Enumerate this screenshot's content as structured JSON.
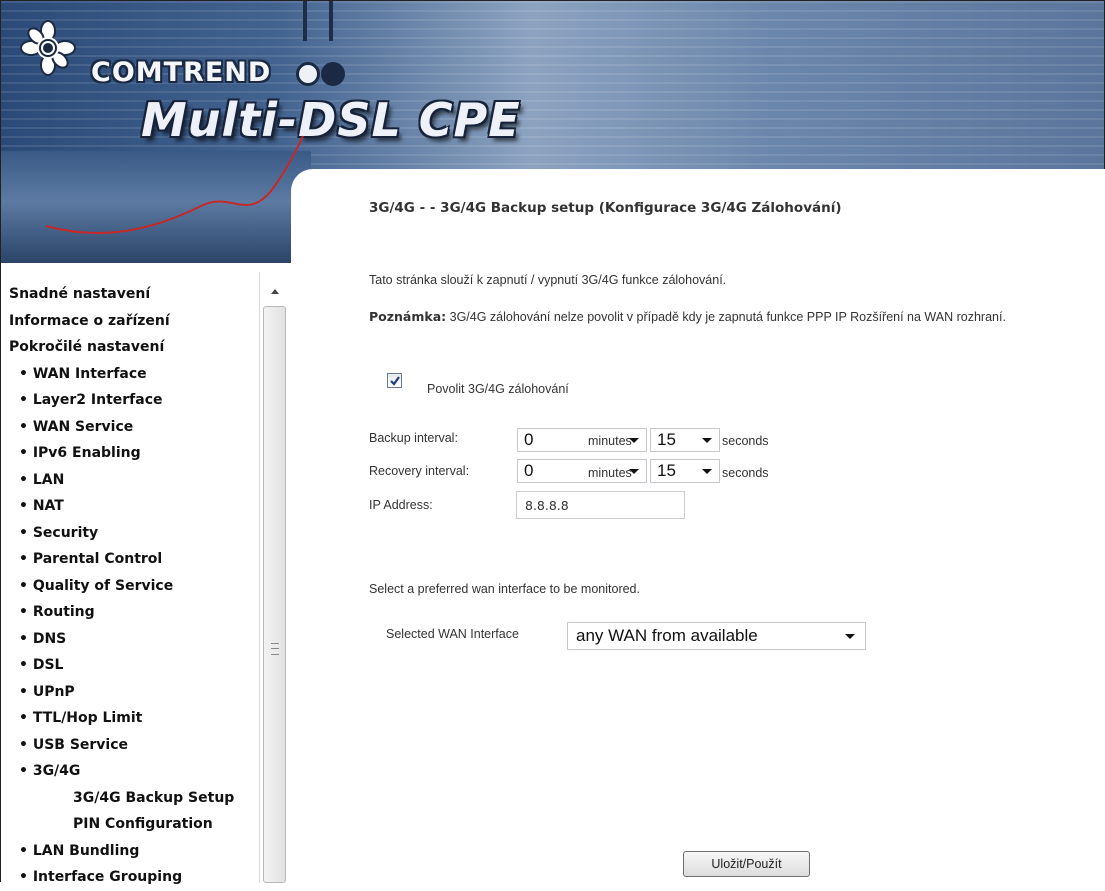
{
  "brand": {
    "company": "COMTREND",
    "product": "Multi-DSL CPE"
  },
  "page": {
    "heading": "3G/4G - - 3G/4G Backup setup (Konfigurace 3G/4G Zálohování)",
    "description": "Tato stránka slouží k zapnutí / vypnutí 3G/4G funkce zálohování.",
    "note_label": "Poznámka:",
    "note_text": " 3G/4G zálohování nelze povolit v případě kdy je zapnutá funkce PPP IP Rozšíření na WAN rozhraní."
  },
  "form": {
    "enable_checked": true,
    "enable_label": "Povolit 3G/4G zálohování",
    "backup_interval": {
      "label": "Backup interval:",
      "minutes_value": "0",
      "minutes_unit": "minutes",
      "seconds_value": "15",
      "seconds_unit": "seconds"
    },
    "recovery_interval": {
      "label": "Recovery interval:",
      "minutes_value": "0",
      "minutes_unit": "minutes",
      "seconds_value": "15",
      "seconds_unit": "seconds"
    },
    "ip_address": {
      "label": "IP Address:",
      "value": "8.8.8.8"
    },
    "wan_hint": "Select a preferred wan interface to be monitored.",
    "wan_label": "Selected WAN Interface",
    "wan_value": "any WAN from available",
    "apply_label": "Uložit/Použít"
  },
  "sidebar": {
    "items": [
      {
        "label": "Snadné nastavení",
        "level": 0
      },
      {
        "label": "Informace o zařízení",
        "level": 0
      },
      {
        "label": "Pokročilé nastavení",
        "level": 0
      },
      {
        "label": "• WAN Interface",
        "level": 1
      },
      {
        "label": "• Layer2 Interface",
        "level": 1
      },
      {
        "label": "• WAN Service",
        "level": 1
      },
      {
        "label": "• IPv6 Enabling",
        "level": 1
      },
      {
        "label": "• LAN",
        "level": 1
      },
      {
        "label": "• NAT",
        "level": 1
      },
      {
        "label": "• Security",
        "level": 1
      },
      {
        "label": "• Parental Control",
        "level": 1
      },
      {
        "label": "• Quality of Service",
        "level": 1
      },
      {
        "label": "• Routing",
        "level": 1
      },
      {
        "label": "• DNS",
        "level": 1
      },
      {
        "label": "• DSL",
        "level": 1
      },
      {
        "label": "• UPnP",
        "level": 1
      },
      {
        "label": "• TTL/Hop Limit",
        "level": 1
      },
      {
        "label": "• USB Service",
        "level": 1
      },
      {
        "label": "• 3G/4G",
        "level": 1
      },
      {
        "label": "3G/4G Backup Setup",
        "level": 2
      },
      {
        "label": "PIN Configuration",
        "level": 2
      },
      {
        "label": "• LAN Bundling",
        "level": 1
      },
      {
        "label": "• Interface Grouping",
        "level": 1
      }
    ]
  }
}
